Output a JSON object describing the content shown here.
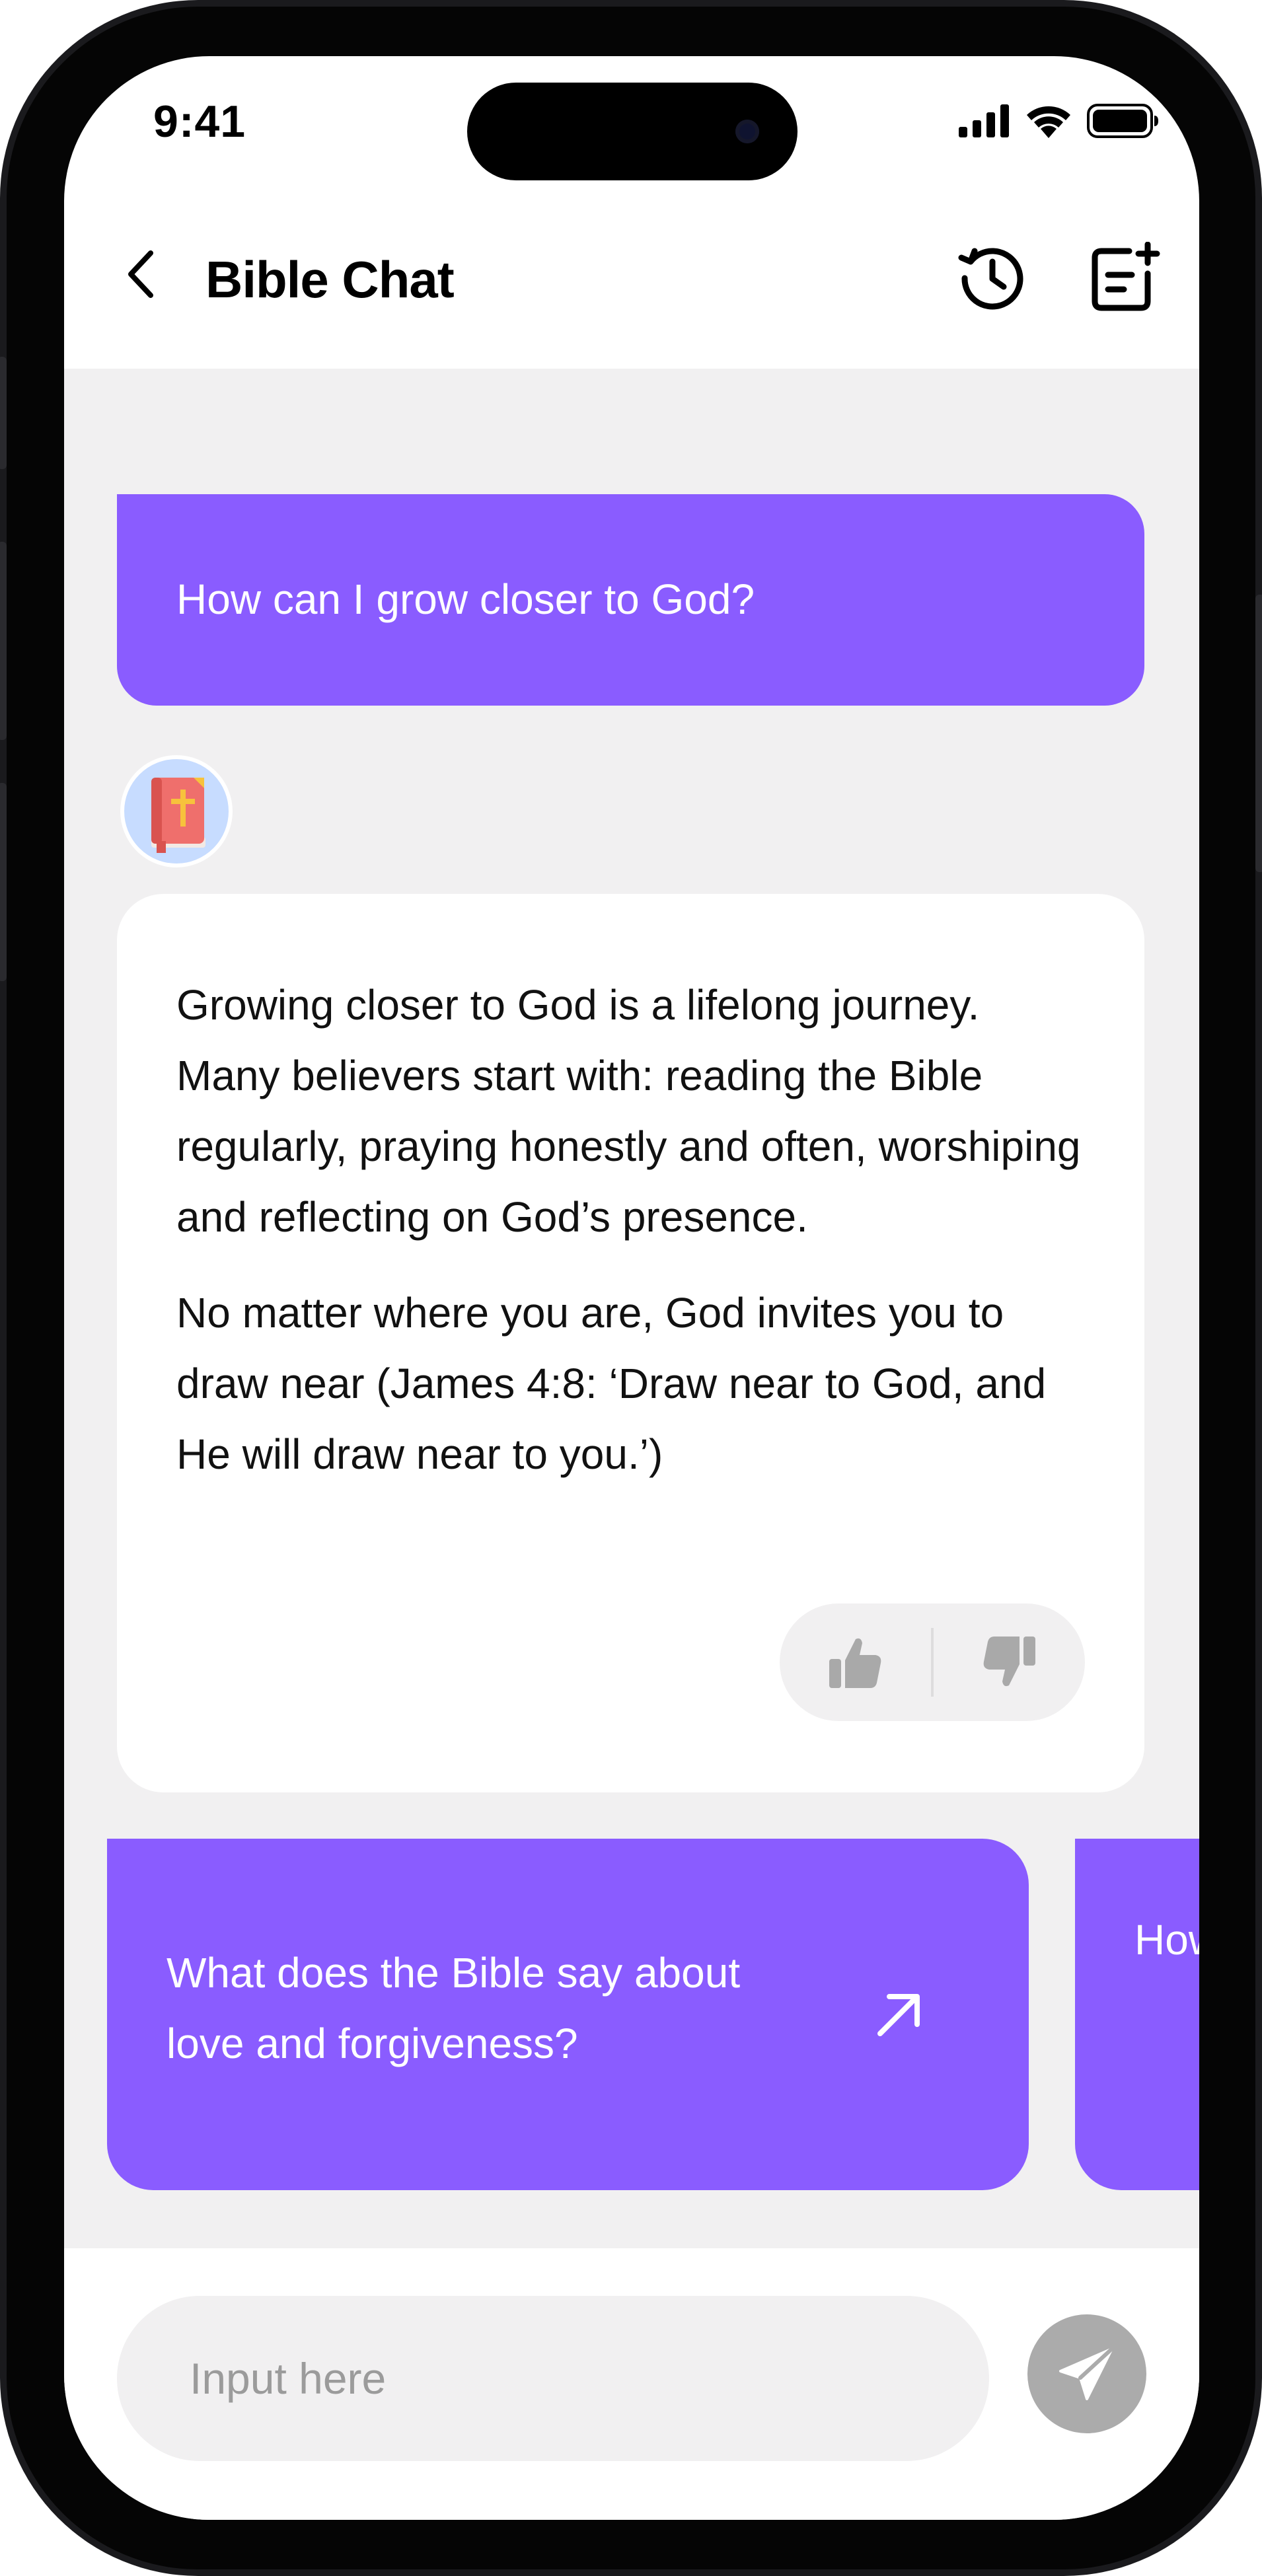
{
  "status_bar": {
    "time": "9:41",
    "icons": [
      "cellular-signal-icon",
      "wifi-icon",
      "battery-icon"
    ]
  },
  "header": {
    "title": "Bible Chat",
    "back_icon": "chevron-left-icon",
    "history_icon": "history-clock-icon",
    "new_chat_icon": "new-chat-icon"
  },
  "conversation": {
    "user_message": "How can I grow closer to God?",
    "bot_avatar_icon": "holy-bible-book-icon",
    "bot_paragraphs": [
      "Growing closer to God is a lifelong journey. Many believers start with: reading the Bible regularly, praying honestly and often, worshiping and reflecting on God’s presence.",
      "No matter where you are, God invites you to draw near (James 4:8: ‘Draw near to God, and He will draw near to you.’)"
    ],
    "feedback": {
      "like_icon": "thumbs-up-icon",
      "dislike_icon": "thumbs-down-icon"
    }
  },
  "suggestions": [
    {
      "text": "What does the Bible say about love and forgiveness?",
      "icon": "arrow-up-right-icon"
    },
    {
      "text": "How \"We Gos"
    }
  ],
  "input": {
    "placeholder": "Input here",
    "value": "",
    "send_icon": "paper-plane-icon"
  },
  "colors": {
    "accent": "#8a5cff",
    "chat_background": "#f1f0f1",
    "send_button_disabled": "#ababab",
    "feedback_icon": "#a9a9a9"
  }
}
